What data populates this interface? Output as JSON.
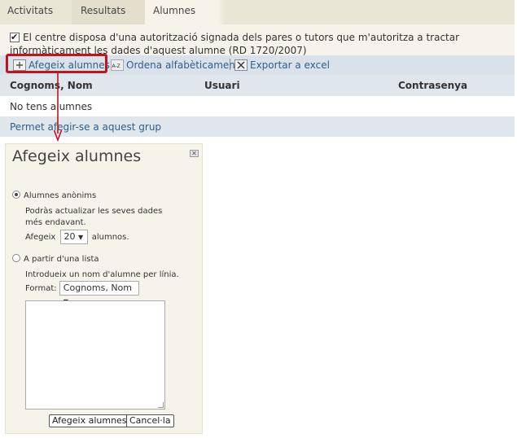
{
  "tabs": [
    {
      "label": "Activitats"
    },
    {
      "label": "Resultats"
    },
    {
      "label": "Alumnes"
    }
  ],
  "consent": {
    "checked": true,
    "text": "El centre disposa d'una autorització signada dels pares o tutors que m'autoritza a tractar informàticament les dades d'aquest alumne (RD 1720/2007)"
  },
  "toolbar": {
    "add_label": "Afegeix alumnes",
    "add_icon": "plus-icon",
    "sort_label": "Ordena alfabèticament",
    "sort_icon": "sort-az-icon",
    "export_label": "Exportar a excel",
    "export_icon": "excel-icon"
  },
  "table": {
    "headers": [
      "Cognoms, Nom",
      "Usuari",
      "Contrasenya"
    ],
    "empty_text": "No tens alumnes",
    "footer_link": "Permet afegir-se a aquest grup"
  },
  "dialog": {
    "title": "Afegeix alumnes",
    "close_icon": "close-icon",
    "option_anon": {
      "label": "Alumnes anònims",
      "selected": true,
      "desc": "Podràs actualizar les seves dades més endavant.",
      "count_prefix": "Afegeix",
      "count_value": "20",
      "count_suffix": "alumnos."
    },
    "option_list": {
      "label": "A partir d'una lista",
      "selected": false,
      "desc": "Introdueix un nom d'alumne per línia.",
      "format_label": "Format:",
      "format_value": "Cognoms, Nom"
    },
    "textarea_value": "",
    "submit_label": "Afegeix alumnes",
    "cancel_label": "Cancel·la"
  },
  "colors": {
    "accent_red": "#c0141e",
    "link_blue": "#2e5f8c",
    "panel_beige": "#f6f4ea",
    "header_blue": "#dfe6ec"
  }
}
